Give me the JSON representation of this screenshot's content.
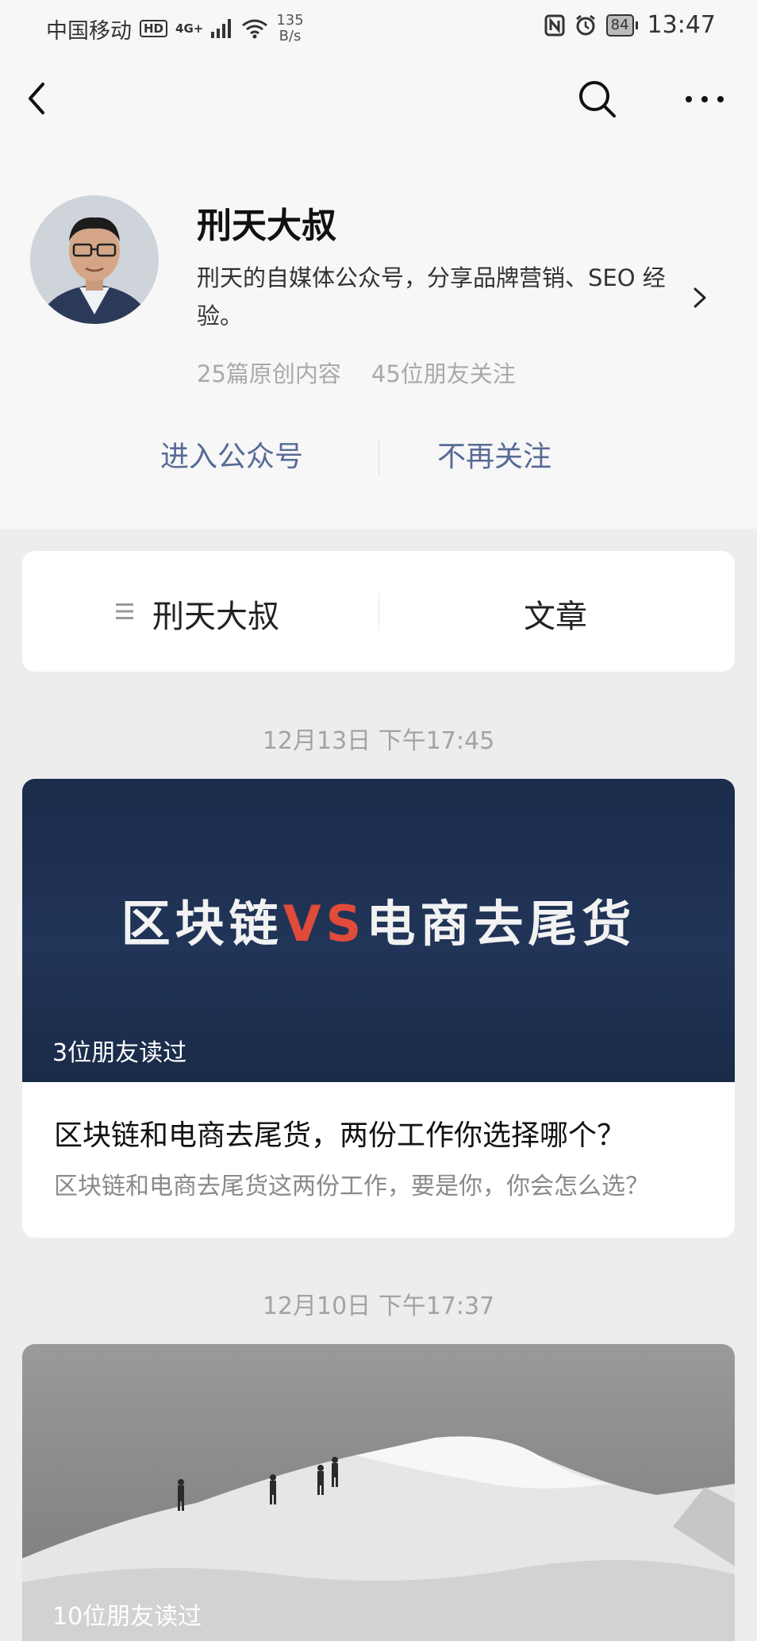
{
  "status_bar": {
    "carrier": "中国移动",
    "hd": "HD",
    "signal": "4G+",
    "speed_value": "135",
    "speed_unit": "B/s",
    "battery": "84",
    "time": "13:47"
  },
  "profile": {
    "name": "刑天大叔",
    "description": "刑天的自媒体公众号，分享品牌营销、SEO 经验。",
    "original_count": "25篇原创内容",
    "friends_following": "45位朋友关注",
    "enter_button": "进入公众号",
    "unfollow_button": "不再关注"
  },
  "tabs": {
    "menu_label": "刑天大叔",
    "articles_label": "文章"
  },
  "articles": [
    {
      "date": "12月13日 下午17:45",
      "cover_text_left": "区块链",
      "cover_text_vs": "VS",
      "cover_text_right": "电商去尾货",
      "read_count": "3位朋友读过",
      "title": "区块链和电商去尾货，两份工作你选择哪个？",
      "summary": "区块链和电商去尾货这两份工作，要是你，你会怎么选？"
    },
    {
      "date": "12月10日 下午17:37",
      "read_count": "10位朋友读过"
    }
  ],
  "colors": {
    "link_blue": "#576b95",
    "page_bg": "#ededed",
    "cover_navy": "#1f3255",
    "vs_red": "#e04b3a"
  }
}
